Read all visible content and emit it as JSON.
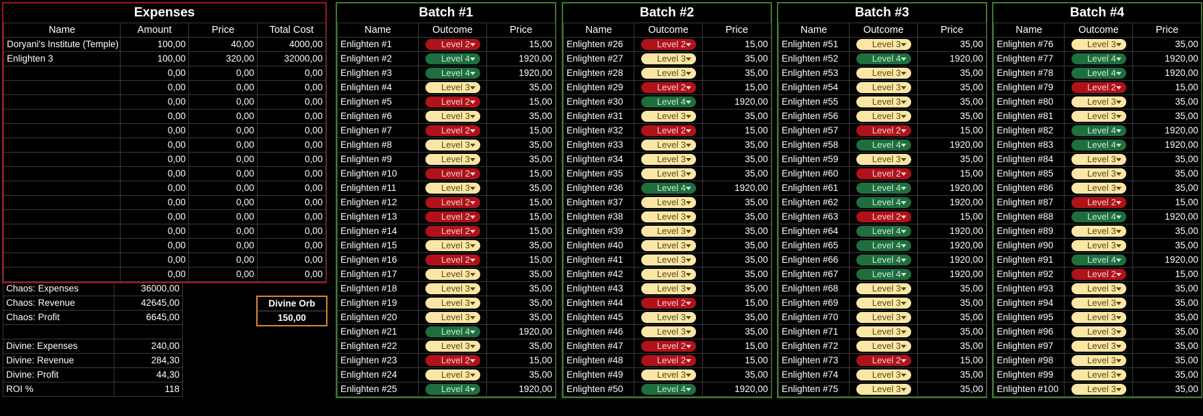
{
  "expenses": {
    "title": "Expenses",
    "headers": [
      "Name",
      "Amount",
      "Price",
      "Total Cost"
    ],
    "rows": [
      [
        "Doryani's Institute (Temple)",
        "100,00",
        "40,00",
        "4000,00"
      ],
      [
        "Enlighten 3",
        "100,00",
        "320,00",
        "32000,00"
      ],
      [
        "",
        "0,00",
        "0,00",
        "0,00"
      ],
      [
        "",
        "0,00",
        "0,00",
        "0,00"
      ],
      [
        "",
        "0,00",
        "0,00",
        "0,00"
      ],
      [
        "",
        "0,00",
        "0,00",
        "0,00"
      ],
      [
        "",
        "0,00",
        "0,00",
        "0,00"
      ],
      [
        "",
        "0,00",
        "0,00",
        "0,00"
      ],
      [
        "",
        "0,00",
        "0,00",
        "0,00"
      ],
      [
        "",
        "0,00",
        "0,00",
        "0,00"
      ],
      [
        "",
        "0,00",
        "0,00",
        "0,00"
      ],
      [
        "",
        "0,00",
        "0,00",
        "0,00"
      ],
      [
        "",
        "0,00",
        "0,00",
        "0,00"
      ],
      [
        "",
        "0,00",
        "0,00",
        "0,00"
      ],
      [
        "",
        "0,00",
        "0,00",
        "0,00"
      ],
      [
        "",
        "0,00",
        "0,00",
        "0,00"
      ],
      [
        "",
        "0,00",
        "0,00",
        "0,00"
      ]
    ]
  },
  "summary": [
    {
      "label": "Chaos: Expenses",
      "value": "36000,00"
    },
    {
      "label": "Chaos: Revenue",
      "value": "42645,00"
    },
    {
      "label": "Chaos: Profit",
      "value": "6645,00"
    },
    {
      "label": "",
      "value": ""
    },
    {
      "label": "Divine: Expenses",
      "value": "240,00"
    },
    {
      "label": "Divine: Revenue",
      "value": "284,30"
    },
    {
      "label": "Divine: Profit",
      "value": "44,30"
    },
    {
      "label": "ROI %",
      "value": "118"
    }
  ],
  "divine_orb": {
    "label": "Divine Orb",
    "value": "150,00"
  },
  "batches": [
    {
      "title": "Batch #1",
      "headers": [
        "Name",
        "Outcome",
        "Price"
      ],
      "rows": [
        [
          "Enlighten #1",
          "Level 2",
          "15,00"
        ],
        [
          "Enlighten #2",
          "Level 4",
          "1920,00"
        ],
        [
          "Enlighten #3",
          "Level 4",
          "1920,00"
        ],
        [
          "Enlighten #4",
          "Level 3",
          "35,00"
        ],
        [
          "Enlighten #5",
          "Level 2",
          "15,00"
        ],
        [
          "Enlighten #6",
          "Level 3",
          "35,00"
        ],
        [
          "Enlighten #7",
          "Level 2",
          "15,00"
        ],
        [
          "Enlighten #8",
          "Level 3",
          "35,00"
        ],
        [
          "Enlighten #9",
          "Level 3",
          "35,00"
        ],
        [
          "Enlighten #10",
          "Level 2",
          "15,00"
        ],
        [
          "Enlighten #11",
          "Level 3",
          "35,00"
        ],
        [
          "Enlighten #12",
          "Level 2",
          "15,00"
        ],
        [
          "Enlighten #13",
          "Level 2",
          "15,00"
        ],
        [
          "Enlighten #14",
          "Level 2",
          "15,00"
        ],
        [
          "Enlighten #15",
          "Level 3",
          "35,00"
        ],
        [
          "Enlighten #16",
          "Level 2",
          "15,00"
        ],
        [
          "Enlighten #17",
          "Level 3",
          "35,00"
        ],
        [
          "Enlighten #18",
          "Level 3",
          "35,00"
        ],
        [
          "Enlighten #19",
          "Level 3",
          "35,00"
        ],
        [
          "Enlighten #20",
          "Level 3",
          "35,00"
        ],
        [
          "Enlighten #21",
          "Level 4",
          "1920,00"
        ],
        [
          "Enlighten #22",
          "Level 3",
          "35,00"
        ],
        [
          "Enlighten #23",
          "Level 2",
          "15,00"
        ],
        [
          "Enlighten #24",
          "Level 3",
          "35,00"
        ],
        [
          "Enlighten #25",
          "Level 4",
          "1920,00"
        ]
      ]
    },
    {
      "title": "Batch #2",
      "headers": [
        "Name",
        "Outcome",
        "Price"
      ],
      "rows": [
        [
          "Enlighten #26",
          "Level 2",
          "15,00"
        ],
        [
          "Enlighten #27",
          "Level 3",
          "35,00"
        ],
        [
          "Enlighten #28",
          "Level 3",
          "35,00"
        ],
        [
          "Enlighten #29",
          "Level 2",
          "15,00"
        ],
        [
          "Enlighten #30",
          "Level 4",
          "1920,00"
        ],
        [
          "Enlighten #31",
          "Level 3",
          "35,00"
        ],
        [
          "Enlighten #32",
          "Level 2",
          "15,00"
        ],
        [
          "Enlighten #33",
          "Level 3",
          "35,00"
        ],
        [
          "Enlighten #34",
          "Level 3",
          "35,00"
        ],
        [
          "Enlighten #35",
          "Level 3",
          "35,00"
        ],
        [
          "Enlighten #36",
          "Level 4",
          "1920,00"
        ],
        [
          "Enlighten #37",
          "Level 3",
          "35,00"
        ],
        [
          "Enlighten #38",
          "Level 3",
          "35,00"
        ],
        [
          "Enlighten #39",
          "Level 3",
          "35,00"
        ],
        [
          "Enlighten #40",
          "Level 3",
          "35,00"
        ],
        [
          "Enlighten #41",
          "Level 3",
          "35,00"
        ],
        [
          "Enlighten #42",
          "Level 3",
          "35,00"
        ],
        [
          "Enlighten #43",
          "Level 3",
          "35,00"
        ],
        [
          "Enlighten #44",
          "Level 2",
          "15,00"
        ],
        [
          "Enlighten #45",
          "Level 3",
          "35,00"
        ],
        [
          "Enlighten #46",
          "Level 3",
          "35,00"
        ],
        [
          "Enlighten #47",
          "Level 2",
          "15,00"
        ],
        [
          "Enlighten #48",
          "Level 2",
          "15,00"
        ],
        [
          "Enlighten #49",
          "Level 3",
          "35,00"
        ],
        [
          "Enlighten #50",
          "Level 4",
          "1920,00"
        ]
      ]
    },
    {
      "title": "Batch #3",
      "headers": [
        "Name",
        "Outcome",
        "Price"
      ],
      "rows": [
        [
          "Enlighten #51",
          "Level 3",
          "35,00"
        ],
        [
          "Enlighten #52",
          "Level 4",
          "1920,00"
        ],
        [
          "Enlighten #53",
          "Level 3",
          "35,00"
        ],
        [
          "Enlighten #54",
          "Level 3",
          "35,00"
        ],
        [
          "Enlighten #55",
          "Level 3",
          "35,00"
        ],
        [
          "Enlighten #56",
          "Level 3",
          "35,00"
        ],
        [
          "Enlighten #57",
          "Level 2",
          "15,00"
        ],
        [
          "Enlighten #58",
          "Level 4",
          "1920,00"
        ],
        [
          "Enlighten #59",
          "Level 3",
          "35,00"
        ],
        [
          "Enlighten #60",
          "Level 2",
          "15,00"
        ],
        [
          "Enlighten #61",
          "Level 4",
          "1920,00"
        ],
        [
          "Enlighten #62",
          "Level 4",
          "1920,00"
        ],
        [
          "Enlighten #63",
          "Level 2",
          "15,00"
        ],
        [
          "Enlighten #64",
          "Level 4",
          "1920,00"
        ],
        [
          "Enlighten #65",
          "Level 4",
          "1920,00"
        ],
        [
          "Enlighten #66",
          "Level 4",
          "1920,00"
        ],
        [
          "Enlighten #67",
          "Level 4",
          "1920,00"
        ],
        [
          "Enlighten #68",
          "Level 3",
          "35,00"
        ],
        [
          "Enlighten #69",
          "Level 3",
          "35,00"
        ],
        [
          "Enlighten #70",
          "Level 3",
          "35,00"
        ],
        [
          "Enlighten #71",
          "Level 3",
          "35,00"
        ],
        [
          "Enlighten #72",
          "Level 3",
          "35,00"
        ],
        [
          "Enlighten #73",
          "Level 2",
          "15,00"
        ],
        [
          "Enlighten #74",
          "Level 3",
          "35,00"
        ],
        [
          "Enlighten #75",
          "Level 3",
          "35,00"
        ]
      ]
    },
    {
      "title": "Batch #4",
      "headers": [
        "Name",
        "Outcome",
        "Price"
      ],
      "rows": [
        [
          "Enlighten #76",
          "Level 3",
          "35,00"
        ],
        [
          "Enlighten #77",
          "Level 4",
          "1920,00"
        ],
        [
          "Enlighten #78",
          "Level 4",
          "1920,00"
        ],
        [
          "Enlighten #79",
          "Level 2",
          "15,00"
        ],
        [
          "Enlighten #80",
          "Level 3",
          "35,00"
        ],
        [
          "Enlighten #81",
          "Level 3",
          "35,00"
        ],
        [
          "Enlighten #82",
          "Level 4",
          "1920,00"
        ],
        [
          "Enlighten #83",
          "Level 4",
          "1920,00"
        ],
        [
          "Enlighten #84",
          "Level 3",
          "35,00"
        ],
        [
          "Enlighten #85",
          "Level 3",
          "35,00"
        ],
        [
          "Enlighten #86",
          "Level 3",
          "35,00"
        ],
        [
          "Enlighten #87",
          "Level 2",
          "15,00"
        ],
        [
          "Enlighten #88",
          "Level 4",
          "1920,00"
        ],
        [
          "Enlighten #89",
          "Level 3",
          "35,00"
        ],
        [
          "Enlighten #90",
          "Level 3",
          "35,00"
        ],
        [
          "Enlighten #91",
          "Level 4",
          "1920,00"
        ],
        [
          "Enlighten #92",
          "Level 2",
          "15,00"
        ],
        [
          "Enlighten #93",
          "Level 3",
          "35,00"
        ],
        [
          "Enlighten #94",
          "Level 3",
          "35,00"
        ],
        [
          "Enlighten #95",
          "Level 3",
          "35,00"
        ],
        [
          "Enlighten #96",
          "Level 3",
          "35,00"
        ],
        [
          "Enlighten #97",
          "Level 3",
          "35,00"
        ],
        [
          "Enlighten #98",
          "Level 3",
          "35,00"
        ],
        [
          "Enlighten #99",
          "Level 3",
          "35,00"
        ],
        [
          "Enlighten #100",
          "Level 3",
          "35,00"
        ]
      ]
    }
  ],
  "colors": {
    "level2": "#b0121a",
    "level3": "#fbe7a5",
    "level4": "#1e6e3e",
    "expenses_border": "#a01818",
    "batch_border": "#3e7a2c",
    "divine_border": "#d68a2a"
  }
}
